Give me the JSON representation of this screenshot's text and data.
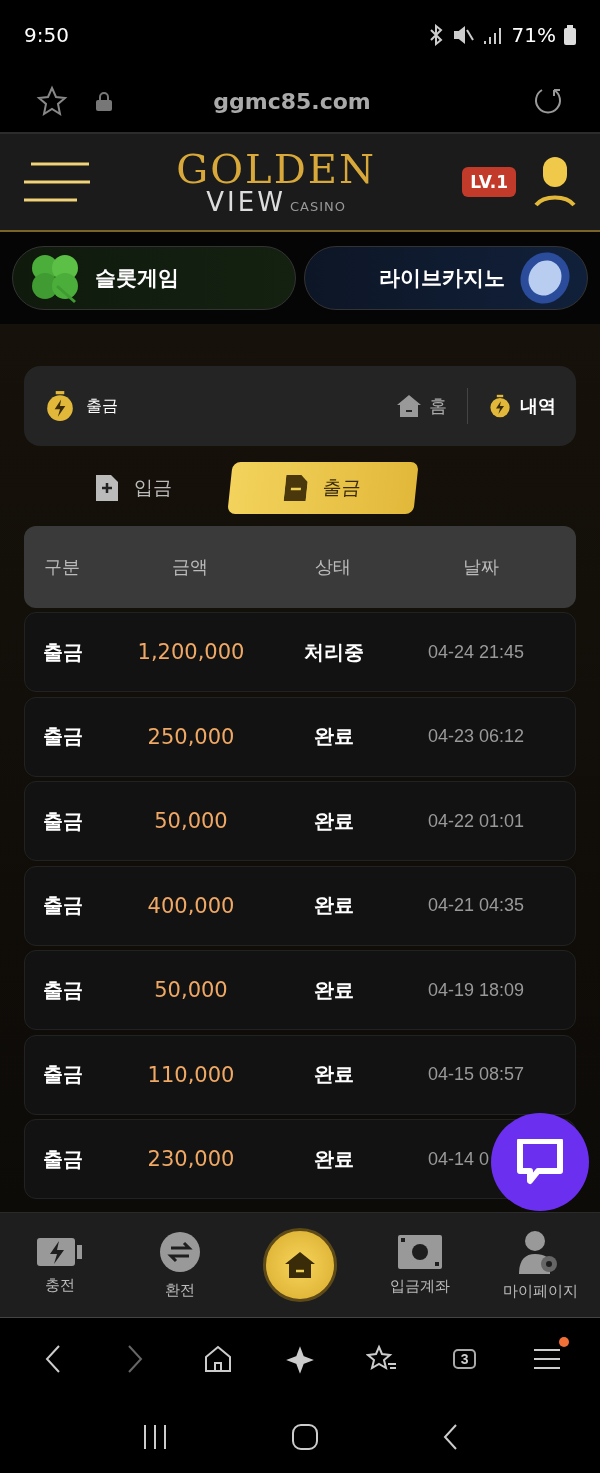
{
  "status_bar": {
    "time": "9:50",
    "battery": "71%"
  },
  "address_bar": {
    "url": "ggmc85.com"
  },
  "header": {
    "logo": {
      "word_1": "GOLDEN",
      "word_2": "VIEW",
      "word_3": "CASINO"
    },
    "level_badge": "LV.1"
  },
  "game_banners": [
    {
      "kind": "slot",
      "label": "슬롯게임"
    },
    {
      "kind": "live",
      "label": "라이브카지노"
    }
  ],
  "page_panel": {
    "title": "출금",
    "home_link": "홈",
    "history_link": "내역"
  },
  "tabs": [
    {
      "kind": "deposit",
      "label": "입금",
      "selected": false
    },
    {
      "kind": "withdraw",
      "label": "출금",
      "selected": true
    }
  ],
  "table": {
    "columns": [
      "구분",
      "금액",
      "상태",
      "날짜"
    ],
    "rows": [
      {
        "type": "출금",
        "amount": "1,200,000",
        "status": "처리중",
        "date": "04-24 21:45"
      },
      {
        "type": "출금",
        "amount": "250,000",
        "status": "완료",
        "date": "04-23 06:12"
      },
      {
        "type": "출금",
        "amount": "50,000",
        "status": "완료",
        "date": "04-22 01:01"
      },
      {
        "type": "출금",
        "amount": "400,000",
        "status": "완료",
        "date": "04-21 04:35"
      },
      {
        "type": "출금",
        "amount": "50,000",
        "status": "완료",
        "date": "04-19 18:09"
      },
      {
        "type": "출금",
        "amount": "110,000",
        "status": "완료",
        "date": "04-15 08:57"
      },
      {
        "type": "출금",
        "amount": "230,000",
        "status": "완료",
        "date": "04-14 0"
      }
    ]
  },
  "bottom_nav": [
    {
      "kind": "charge",
      "label": "충전"
    },
    {
      "kind": "exchange",
      "label": "환전"
    },
    {
      "kind": "home"
    },
    {
      "kind": "account",
      "label": "입금계좌"
    },
    {
      "kind": "mypage",
      "label": "마이페이지"
    }
  ],
  "browser_toolbar": {
    "tab_count": "3",
    "menu_badge": true
  }
}
